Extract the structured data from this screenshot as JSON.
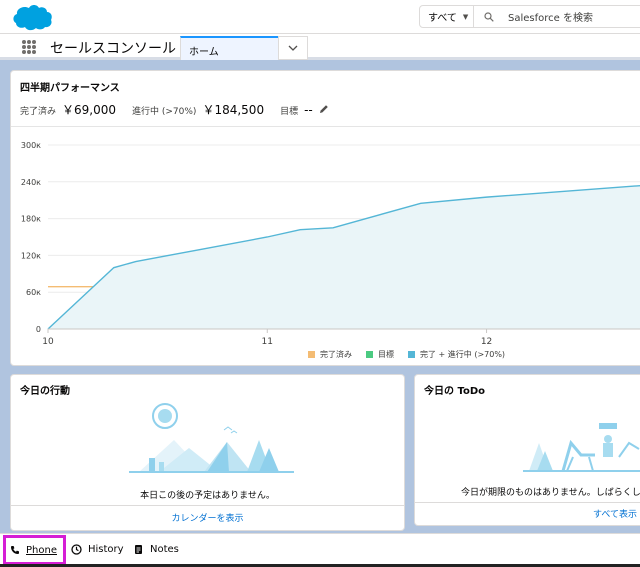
{
  "header": {
    "search_scope": "すべて",
    "search_placeholder": "Salesforce を検索"
  },
  "nav": {
    "app_name": "セールスコンソール",
    "active_tab": "ホーム"
  },
  "performance": {
    "title": "四半期パフォーマンス",
    "closed_label": "完了済み",
    "closed_value": "￥69,000",
    "open_label": "進行中 (>70%)",
    "open_value": "￥184,500",
    "goal_label": "目標",
    "goal_value": "--"
  },
  "chart_data": {
    "type": "line",
    "x_tick_labels": [
      "10",
      "11",
      "12"
    ],
    "y_tick_labels": [
      "0",
      "60к",
      "120к",
      "180к",
      "240к",
      "300к"
    ],
    "ylim": [
      0,
      300000
    ],
    "xlim": [
      10,
      12.75
    ],
    "series": [
      {
        "name": "完了済み",
        "color": "#f4bc73",
        "x": [
          10,
          12.75
        ],
        "y": [
          69000,
          69000
        ]
      },
      {
        "name": "目標",
        "color": "#4bca81",
        "x": [],
        "y": []
      },
      {
        "name": "完了 + 進行中 (>70%)",
        "color": "#54b6d6",
        "fill": "#eaf5f8",
        "x": [
          10,
          10.3,
          10.4,
          10.7,
          11,
          11.15,
          11.3,
          11.7,
          12,
          12.75
        ],
        "y": [
          0,
          100000,
          110000,
          130000,
          150000,
          162000,
          165000,
          205000,
          215000,
          235000
        ]
      }
    ],
    "grid": true,
    "legend_position": "bottom"
  },
  "events": {
    "title": "今日の行動",
    "empty_message": "本日この後の予定はありません。",
    "footer_link": "カレンダーを表示"
  },
  "todo": {
    "title": "今日の ToDo",
    "empty_message": "今日が期限のものはありません。しばらくし",
    "footer_link": "すべて表示"
  },
  "utility_bar": {
    "phone": "Phone",
    "history": "History",
    "notes": "Notes"
  },
  "colors": {
    "brand_blue": "#00a1e0",
    "background": "#b0c4df",
    "link": "#0070d2",
    "highlight_box": "#d51ed5"
  }
}
